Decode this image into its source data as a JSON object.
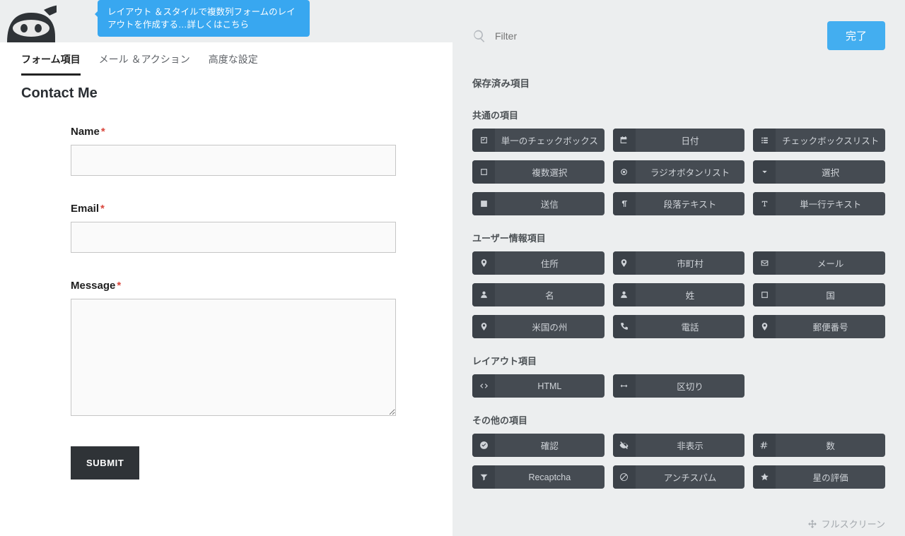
{
  "tip": "レイアウト ＆スタイルで複数列フォームのレイアウトを作成する…詳しくはこちら",
  "tabs": {
    "fields": "フォーム項目",
    "emails": "メール ＆アクション",
    "advanced": "高度な設定"
  },
  "form_title": "Contact Me",
  "form": {
    "name_label": "Name",
    "email_label": "Email",
    "message_label": "Message",
    "submit_label": "SUBMIT"
  },
  "filter_placeholder": "Filter",
  "done_label": "完了",
  "sections": {
    "saved": "保存済み項目",
    "common": "共通の項目",
    "user": "ユーザー情報項目",
    "layout": "レイアウト項目",
    "misc": "その他の項目"
  },
  "common_fields": [
    {
      "icon": "check-square",
      "label": "単一のチェックボックス"
    },
    {
      "icon": "calendar",
      "label": "日付"
    },
    {
      "icon": "list",
      "label": "チェックボックスリスト"
    },
    {
      "icon": "square",
      "label": "複数選択"
    },
    {
      "icon": "target",
      "label": "ラジオボタンリスト"
    },
    {
      "icon": "chevron-down",
      "label": "選択"
    },
    {
      "icon": "square-filled",
      "label": "送信"
    },
    {
      "icon": "paragraph",
      "label": "段落テキスト"
    },
    {
      "icon": "text",
      "label": "単一行テキスト"
    }
  ],
  "user_fields": [
    {
      "icon": "pin",
      "label": "住所"
    },
    {
      "icon": "pin",
      "label": "市町村"
    },
    {
      "icon": "mail",
      "label": "メール"
    },
    {
      "icon": "user",
      "label": "名"
    },
    {
      "icon": "user",
      "label": "姓"
    },
    {
      "icon": "square",
      "label": "国"
    },
    {
      "icon": "pin",
      "label": "米国の州"
    },
    {
      "icon": "phone",
      "label": "電話"
    },
    {
      "icon": "pin",
      "label": "郵便番号"
    }
  ],
  "layout_fields": [
    {
      "icon": "code",
      "label": "HTML"
    },
    {
      "icon": "arrows-h",
      "label": "区切り"
    }
  ],
  "misc_fields": [
    {
      "icon": "check-circle",
      "label": "確認"
    },
    {
      "icon": "eye-off",
      "label": "非表示"
    },
    {
      "icon": "hash",
      "label": "数"
    },
    {
      "icon": "filter",
      "label": "Recaptcha"
    },
    {
      "icon": "ban",
      "label": "アンチスパム"
    },
    {
      "icon": "star",
      "label": "星の評価"
    }
  ],
  "fullscreen_label": "フルスクリーン"
}
